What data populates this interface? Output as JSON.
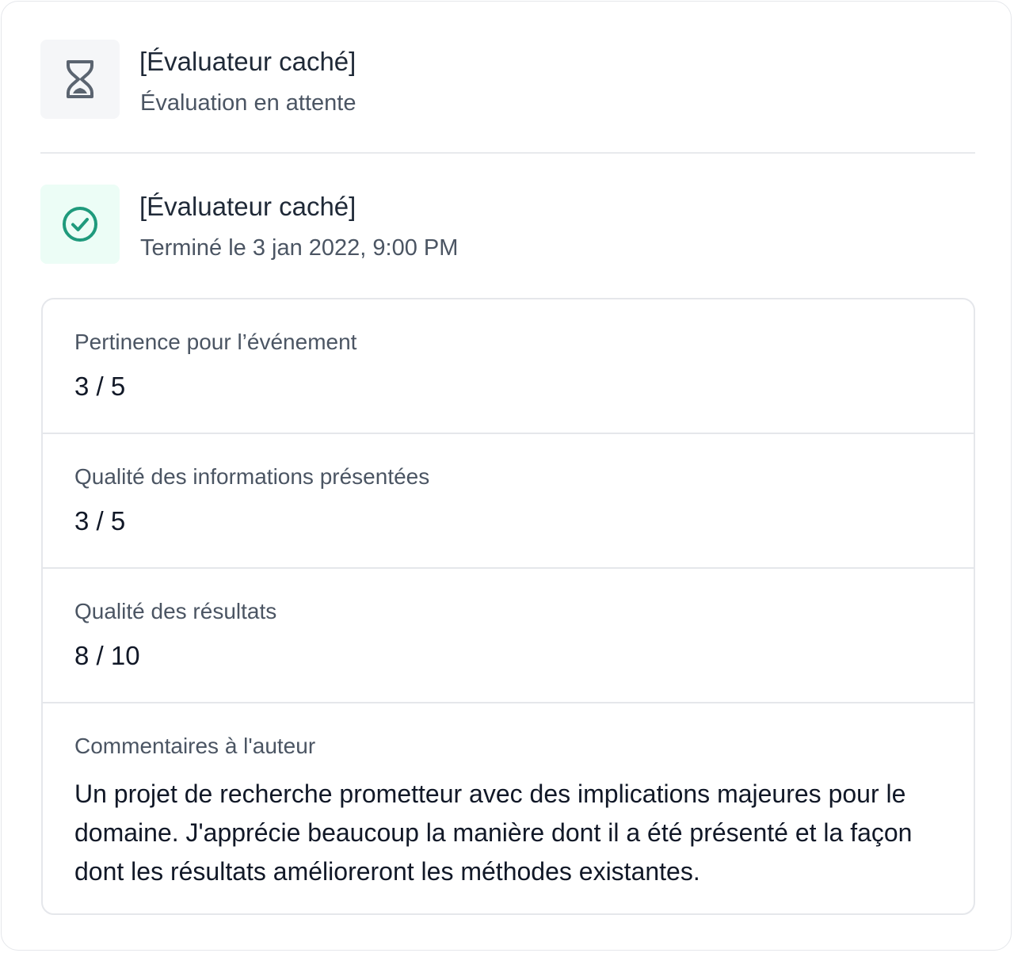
{
  "reviewers": [
    {
      "name": "[Évaluateur caché]",
      "status": "Évaluation en attente",
      "icon": "hourglass-icon"
    },
    {
      "name": "[Évaluateur caché]",
      "status": "Terminé le 3 jan 2022, 9:00 PM",
      "icon": "check-circle-icon"
    }
  ],
  "scores": [
    {
      "label": "Pertinence pour l’événement",
      "value": "3 / 5"
    },
    {
      "label": "Qualité des informations présentées",
      "value": "3 / 5"
    },
    {
      "label": "Qualité des résultats",
      "value": "8 / 10"
    }
  ],
  "comment": {
    "label": "Commentaires à l'auteur",
    "text": "Un projet de recherche prometteur avec des implications majeures pour le domaine. J'apprécie beaucoup la manière dont il a été présenté et la façon dont les résultats amélioreront les méthodes existantes."
  },
  "colors": {
    "pending_icon": "#5b6470",
    "done_icon": "#1f9a7c",
    "done_icon_bg": "#ecfdf6",
    "pending_icon_bg": "#f5f6f8"
  }
}
